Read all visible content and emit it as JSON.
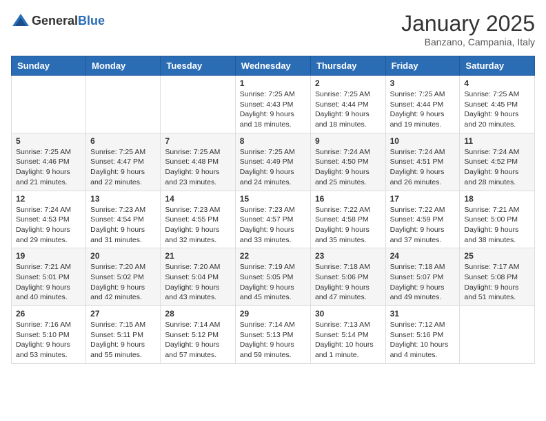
{
  "header": {
    "logo_general": "General",
    "logo_blue": "Blue",
    "month": "January 2025",
    "location": "Banzano, Campania, Italy"
  },
  "weekdays": [
    "Sunday",
    "Monday",
    "Tuesday",
    "Wednesday",
    "Thursday",
    "Friday",
    "Saturday"
  ],
  "weeks": [
    [
      {
        "day": "",
        "info": ""
      },
      {
        "day": "",
        "info": ""
      },
      {
        "day": "",
        "info": ""
      },
      {
        "day": "1",
        "info": "Sunrise: 7:25 AM\nSunset: 4:43 PM\nDaylight: 9 hours\nand 18 minutes."
      },
      {
        "day": "2",
        "info": "Sunrise: 7:25 AM\nSunset: 4:44 PM\nDaylight: 9 hours\nand 18 minutes."
      },
      {
        "day": "3",
        "info": "Sunrise: 7:25 AM\nSunset: 4:44 PM\nDaylight: 9 hours\nand 19 minutes."
      },
      {
        "day": "4",
        "info": "Sunrise: 7:25 AM\nSunset: 4:45 PM\nDaylight: 9 hours\nand 20 minutes."
      }
    ],
    [
      {
        "day": "5",
        "info": "Sunrise: 7:25 AM\nSunset: 4:46 PM\nDaylight: 9 hours\nand 21 minutes."
      },
      {
        "day": "6",
        "info": "Sunrise: 7:25 AM\nSunset: 4:47 PM\nDaylight: 9 hours\nand 22 minutes."
      },
      {
        "day": "7",
        "info": "Sunrise: 7:25 AM\nSunset: 4:48 PM\nDaylight: 9 hours\nand 23 minutes."
      },
      {
        "day": "8",
        "info": "Sunrise: 7:25 AM\nSunset: 4:49 PM\nDaylight: 9 hours\nand 24 minutes."
      },
      {
        "day": "9",
        "info": "Sunrise: 7:24 AM\nSunset: 4:50 PM\nDaylight: 9 hours\nand 25 minutes."
      },
      {
        "day": "10",
        "info": "Sunrise: 7:24 AM\nSunset: 4:51 PM\nDaylight: 9 hours\nand 26 minutes."
      },
      {
        "day": "11",
        "info": "Sunrise: 7:24 AM\nSunset: 4:52 PM\nDaylight: 9 hours\nand 28 minutes."
      }
    ],
    [
      {
        "day": "12",
        "info": "Sunrise: 7:24 AM\nSunset: 4:53 PM\nDaylight: 9 hours\nand 29 minutes."
      },
      {
        "day": "13",
        "info": "Sunrise: 7:23 AM\nSunset: 4:54 PM\nDaylight: 9 hours\nand 31 minutes."
      },
      {
        "day": "14",
        "info": "Sunrise: 7:23 AM\nSunset: 4:55 PM\nDaylight: 9 hours\nand 32 minutes."
      },
      {
        "day": "15",
        "info": "Sunrise: 7:23 AM\nSunset: 4:57 PM\nDaylight: 9 hours\nand 33 minutes."
      },
      {
        "day": "16",
        "info": "Sunrise: 7:22 AM\nSunset: 4:58 PM\nDaylight: 9 hours\nand 35 minutes."
      },
      {
        "day": "17",
        "info": "Sunrise: 7:22 AM\nSunset: 4:59 PM\nDaylight: 9 hours\nand 37 minutes."
      },
      {
        "day": "18",
        "info": "Sunrise: 7:21 AM\nSunset: 5:00 PM\nDaylight: 9 hours\nand 38 minutes."
      }
    ],
    [
      {
        "day": "19",
        "info": "Sunrise: 7:21 AM\nSunset: 5:01 PM\nDaylight: 9 hours\nand 40 minutes."
      },
      {
        "day": "20",
        "info": "Sunrise: 7:20 AM\nSunset: 5:02 PM\nDaylight: 9 hours\nand 42 minutes."
      },
      {
        "day": "21",
        "info": "Sunrise: 7:20 AM\nSunset: 5:04 PM\nDaylight: 9 hours\nand 43 minutes."
      },
      {
        "day": "22",
        "info": "Sunrise: 7:19 AM\nSunset: 5:05 PM\nDaylight: 9 hours\nand 45 minutes."
      },
      {
        "day": "23",
        "info": "Sunrise: 7:18 AM\nSunset: 5:06 PM\nDaylight: 9 hours\nand 47 minutes."
      },
      {
        "day": "24",
        "info": "Sunrise: 7:18 AM\nSunset: 5:07 PM\nDaylight: 9 hours\nand 49 minutes."
      },
      {
        "day": "25",
        "info": "Sunrise: 7:17 AM\nSunset: 5:08 PM\nDaylight: 9 hours\nand 51 minutes."
      }
    ],
    [
      {
        "day": "26",
        "info": "Sunrise: 7:16 AM\nSunset: 5:10 PM\nDaylight: 9 hours\nand 53 minutes."
      },
      {
        "day": "27",
        "info": "Sunrise: 7:15 AM\nSunset: 5:11 PM\nDaylight: 9 hours\nand 55 minutes."
      },
      {
        "day": "28",
        "info": "Sunrise: 7:14 AM\nSunset: 5:12 PM\nDaylight: 9 hours\nand 57 minutes."
      },
      {
        "day": "29",
        "info": "Sunrise: 7:14 AM\nSunset: 5:13 PM\nDaylight: 9 hours\nand 59 minutes."
      },
      {
        "day": "30",
        "info": "Sunrise: 7:13 AM\nSunset: 5:14 PM\nDaylight: 10 hours\nand 1 minute."
      },
      {
        "day": "31",
        "info": "Sunrise: 7:12 AM\nSunset: 5:16 PM\nDaylight: 10 hours\nand 4 minutes."
      },
      {
        "day": "",
        "info": ""
      }
    ]
  ]
}
